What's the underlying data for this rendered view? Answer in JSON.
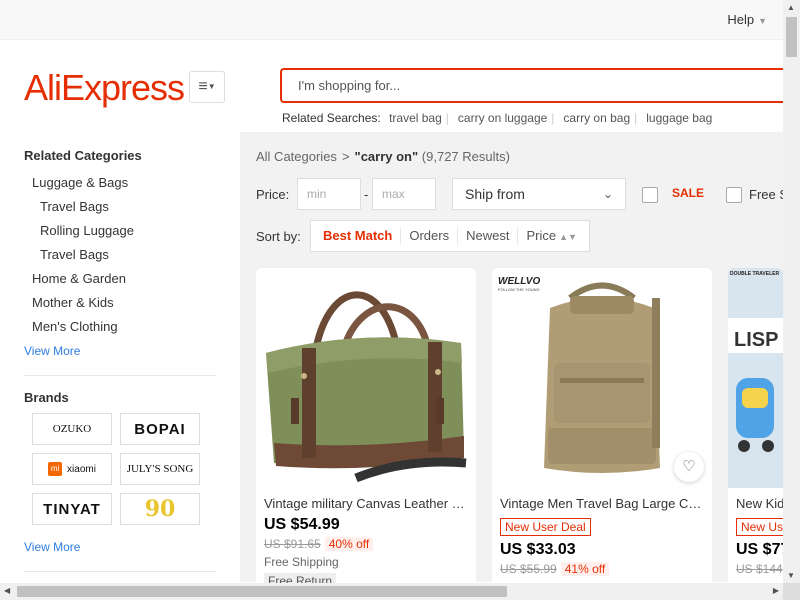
{
  "header": {
    "help_label": "Help",
    "logo_text": "AliExpress",
    "search_placeholder": "I'm shopping for...",
    "related_label": "Related Searches:",
    "related_searches": [
      "travel bag",
      "carry on luggage",
      "carry on bag",
      "luggage bag"
    ]
  },
  "sidebar": {
    "categories_title": "Related Categories",
    "categories": [
      {
        "label": "Luggage & Bags",
        "level": 1
      },
      {
        "label": "Travel Bags",
        "level": 2
      },
      {
        "label": "Rolling Luggage",
        "level": 2
      },
      {
        "label": "Travel Bags",
        "level": 2
      },
      {
        "label": "Home & Garden",
        "level": 1
      },
      {
        "label": "Mother & Kids",
        "level": 1
      },
      {
        "label": "Men's Clothing",
        "level": 1
      }
    ],
    "categories_view_more": "View More",
    "brands_title": "Brands",
    "brands": [
      "OZUKO",
      "BOPAI",
      "xiaomi",
      "JULY'S SONG",
      "TINYAT",
      "90"
    ],
    "brands_view_more": "View More"
  },
  "breadcrumb": {
    "root": "All Categories",
    "arrow": ">",
    "query": "\"carry on\"",
    "results": "(9,727 Results)"
  },
  "filters": {
    "price_label": "Price:",
    "min_placeholder": "min",
    "max_placeholder": "max",
    "dash": "-",
    "ship_from": "Ship from",
    "sale_label": "SALE",
    "free_shipping_label": "Free S"
  },
  "sort": {
    "label": "Sort by:",
    "options": [
      "Best Match",
      "Orders",
      "Newest",
      "Price"
    ],
    "active": "Best Match"
  },
  "products": [
    {
      "title": "Vintage military Canvas Leather m...",
      "badge": "",
      "price": "US $54.99",
      "original_price": "US $91.65",
      "discount": "40% off",
      "shipping": "Free Shipping",
      "return": "Free Return"
    },
    {
      "title": "Vintage Men Travel Bag Large Cap...",
      "badge": "New User Deal",
      "price": "US $33.03",
      "original_price": "US $55.99",
      "discount": "41% off",
      "shipping": "",
      "return": "",
      "brand_mark": "WELLVO",
      "brand_sub": "FOLLOW THE YOUNG"
    },
    {
      "title": "New Kid",
      "badge": "New Us",
      "price": "US $77",
      "original_price": "US $144",
      "discount": "",
      "shipping": "",
      "return": "",
      "brand_mark": "DOUBLE TRAVELER",
      "sign_text": "LISP"
    }
  ],
  "colors": {
    "accent": "#e62e04",
    "link": "#2e7de1",
    "content_bg": "#f2f2f2"
  }
}
